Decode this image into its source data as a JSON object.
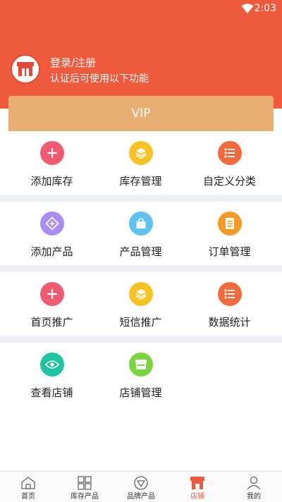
{
  "status": {
    "time": "2:03"
  },
  "header": {
    "login_title": "登录/注册",
    "login_subtitle": "认证后可使用以下功能"
  },
  "vip": {
    "label": "VIP"
  },
  "grid": [
    [
      {
        "label": "添加库存",
        "icon": "plus-icon",
        "color": "#f05b72"
      },
      {
        "label": "库存管理",
        "icon": "layers-icon",
        "color": "#f7c324"
      },
      {
        "label": "自定义分类",
        "icon": "list-icon",
        "color": "#f26a3d"
      }
    ],
    [
      {
        "label": "添加产品",
        "icon": "diamond-plus-icon",
        "color": "#a98ef1"
      },
      {
        "label": "产品管理",
        "icon": "bag-icon",
        "color": "#5ec3f0"
      },
      {
        "label": "订单管理",
        "icon": "document-icon",
        "color": "#f59a26"
      }
    ],
    [
      {
        "label": "首页推广",
        "icon": "plus-icon",
        "color": "#f05b72"
      },
      {
        "label": "短信推广",
        "icon": "layers-icon",
        "color": "#f7c324"
      },
      {
        "label": "数据统计",
        "icon": "list-icon",
        "color": "#f26a3d"
      }
    ],
    [
      {
        "label": "查看店铺",
        "icon": "eye-icon",
        "color": "#1fc4a0"
      },
      {
        "label": "店铺管理",
        "icon": "store-icon",
        "color": "#79d43e"
      }
    ]
  ],
  "nav": [
    {
      "label": "首页",
      "icon": "home-icon",
      "active": false
    },
    {
      "label": "库存产品",
      "icon": "grid-icon",
      "active": false
    },
    {
      "label": "品牌产品",
      "icon": "diamond-icon",
      "active": false
    },
    {
      "label": "店铺",
      "icon": "shop-icon",
      "active": true
    },
    {
      "label": "我的",
      "icon": "profile-icon",
      "active": false
    }
  ],
  "colors": {
    "header": "#ee5a3c",
    "vip": "#e9ae72",
    "accent": "#ee5a3c"
  }
}
